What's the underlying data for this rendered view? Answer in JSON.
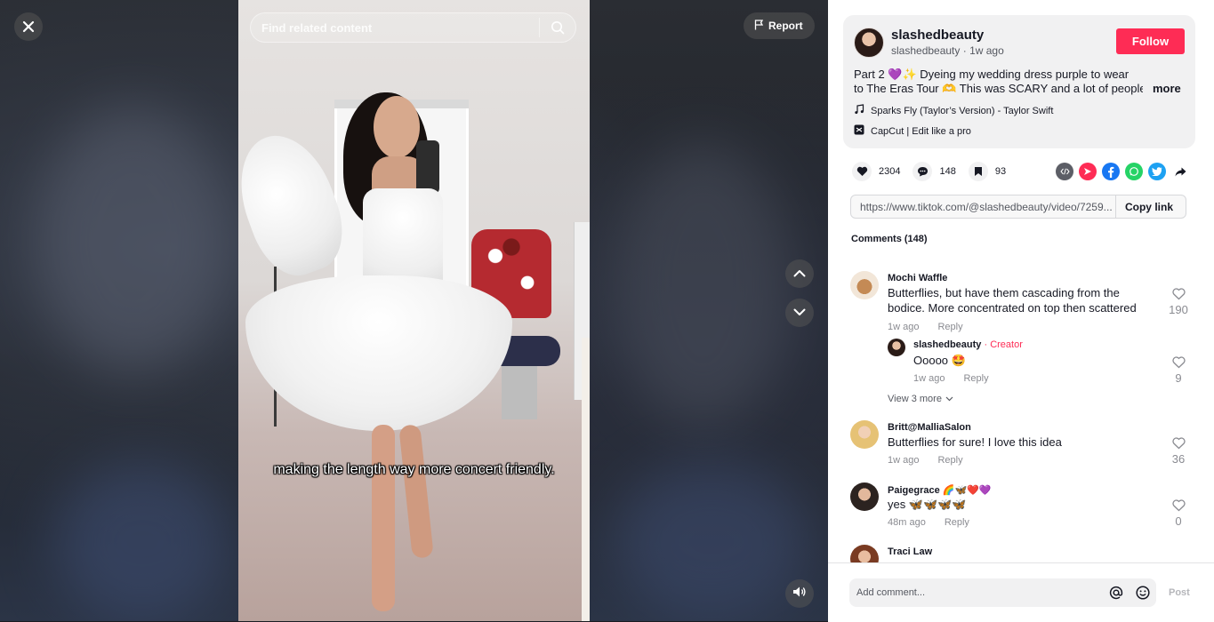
{
  "search": {
    "placeholder": "Find related content"
  },
  "top_bar": {
    "report_label": "Report"
  },
  "video": {
    "caption": "making the length way more concert friendly."
  },
  "post": {
    "author_name": "slashedbeauty",
    "author_handle": "slashedbeauty",
    "posted_time": "1w ago",
    "follow_label": "Follow",
    "caption_line1": "Part 2 💜✨ Dyeing my wedding dress purple to wear",
    "caption_line2": "to The Eras Tour 🫶 This was SCARY and a lot of people...",
    "more_label": "more",
    "music": "Sparks Fly (Taylor’s Version) - Taylor Swift",
    "capcut": "CapCut | Edit like a pro"
  },
  "stats": {
    "likes": "2304",
    "comments": "148",
    "saves": "93"
  },
  "share": {
    "link": "https://www.tiktok.com/@slashedbeauty/video/7259...",
    "copy_label": "Copy link",
    "icons": [
      "embed-icon",
      "send-icon",
      "facebook-icon",
      "whatsapp-icon",
      "twitter-icon",
      "forward-share-icon"
    ]
  },
  "comments_header": "Comments (148)",
  "comments": [
    {
      "name": "Mochi Waffle",
      "text_line1": "Butterflies, but have them cascading from the",
      "text_line2": "bodice. More concentrated on top then scattered",
      "time": "1w ago",
      "reply": "Reply",
      "likes": "190"
    },
    {
      "name": "slashedbeauty",
      "creator_label": "· Creator",
      "text": "Ooooo 🤩",
      "time": "1w ago",
      "reply": "Reply",
      "likes": "9"
    },
    {
      "name": "Britt@MalliaSalon",
      "text": "Butterflies for sure! I love this idea",
      "time": "1w ago",
      "reply": "Reply",
      "likes": "36"
    },
    {
      "name": "Paigegrace 🌈🦋❤️💜",
      "text": "yes 🦋🦋🦋🦋",
      "time": "48m ago",
      "reply": "Reply",
      "likes": "0"
    },
    {
      "name": "Traci Law"
    }
  ],
  "view_more_label": "View 3 more",
  "comment_bar": {
    "placeholder": "Add comment...",
    "post_label": "Post"
  },
  "colors": {
    "accent": "#fe2c55",
    "panel_bg": "#f1f1f2"
  }
}
